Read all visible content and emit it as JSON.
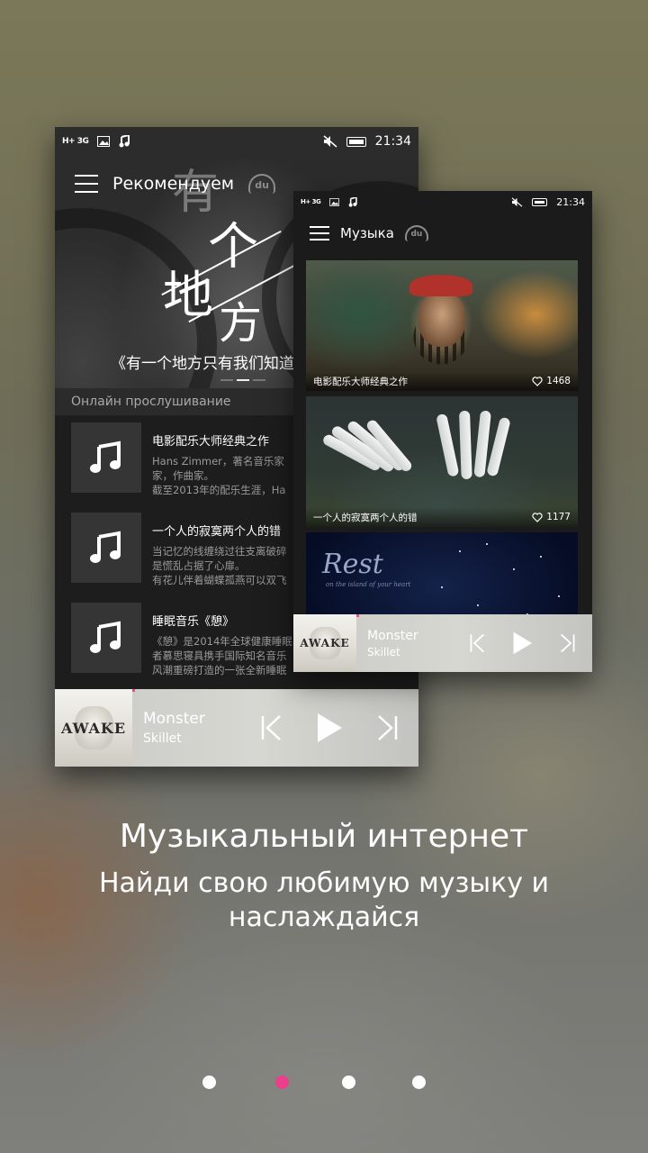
{
  "back_screen": {
    "status": {
      "network": "H+ 3G",
      "time": "21:34"
    },
    "title": "Рекомендуем",
    "logo_text": "du",
    "hero": {
      "art_chars": [
        "有",
        "个",
        "地",
        "方"
      ],
      "caption": "《有一个地方只有我们知道》"
    },
    "section_title": "Онлайн прослушивание",
    "items": [
      {
        "title": "电影配乐大师经典之作",
        "desc_lines": [
          "Hans Zimmer，著名音乐家",
          "家，作曲家。",
          "截至2013年的配乐生涯，Ha"
        ]
      },
      {
        "title": "一个人的寂寞两个人的错",
        "desc_lines": [
          "当记忆的线缠绕过往支离破碎",
          "是慌乱占据了心扉。",
          "有花儿伴着蝴蝶孤燕可以双飞"
        ]
      },
      {
        "title": "睡眠音乐《憩》",
        "desc_lines": [
          "《憩》是2014年全球健康睡眠",
          "者慕思寝具携手国际知名音乐",
          "风潮重磅打造的一张全新睡眠"
        ]
      }
    ],
    "player": {
      "cover_text": "AWAKE",
      "track": "Monster",
      "artist": "Skillet",
      "progress": 0.22
    }
  },
  "front_screen": {
    "status": {
      "network": "H+ 3G",
      "time": "21:34"
    },
    "title": "Музыка",
    "logo_text": "du",
    "cards": [
      {
        "caption": "电影配乐大师经典之作",
        "likes": "1468"
      },
      {
        "caption": "一个人的寂寞两个人的错",
        "likes": "1177"
      },
      {
        "art_title": "Rest",
        "art_sub": "on the island of your heart"
      }
    ],
    "player": {
      "cover_text": "AWAKE",
      "track": "Monster",
      "artist": "Skillet",
      "progress": 0.22
    }
  },
  "headline": "Музыкальный интернет",
  "subline": "Найди свою любимую музыку и наслаждайся",
  "pager": {
    "count": 4,
    "active_index": 1,
    "active_color": "#ea3f8a",
    "dot_color": "#ffffff"
  },
  "colors": {
    "accent": "#e94e8f"
  },
  "icons": [
    "hamburger-icon",
    "du-logo-icon",
    "music-note-icon",
    "heart-icon",
    "prev-icon",
    "play-icon",
    "next-icon",
    "mute-icon",
    "battery-icon",
    "image-icon",
    "signal-icon"
  ]
}
